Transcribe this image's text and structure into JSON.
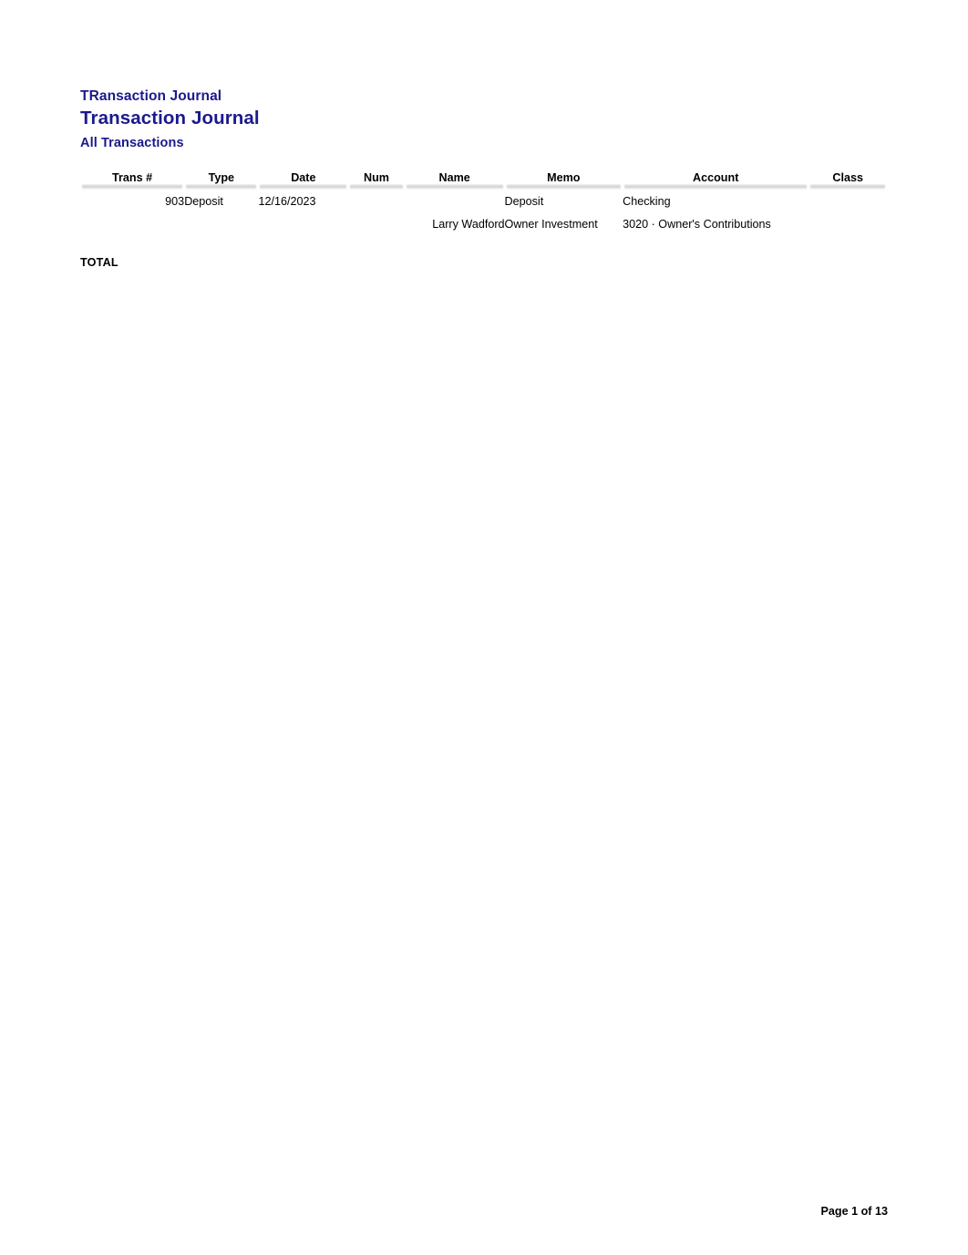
{
  "document": {
    "header_line_1": "TRansaction Journal",
    "header_line_2": "Transaction Journal",
    "subtitle": "All Transactions",
    "accent_color": "#1a1a8c",
    "text_color": "#000000",
    "rule_color": "#8c8c8c",
    "background": "#ffffff"
  },
  "table": {
    "columns": [
      {
        "key": "trans",
        "label": "Trans #"
      },
      {
        "key": "type",
        "label": "Type"
      },
      {
        "key": "date",
        "label": "Date"
      },
      {
        "key": "num",
        "label": "Num"
      },
      {
        "key": "name",
        "label": "Name"
      },
      {
        "key": "memo",
        "label": "Memo"
      },
      {
        "key": "account",
        "label": "Account"
      },
      {
        "key": "class",
        "label": "Class"
      }
    ],
    "rows": [
      {
        "trans": "903",
        "type": "Deposit",
        "date": "12/16/2023",
        "num": "",
        "name": "",
        "memo": "Deposit",
        "account": "Checking",
        "class": ""
      },
      {
        "trans": "",
        "type": "",
        "date": "",
        "num": "",
        "name": "Larry Wadford",
        "memo": "Owner Investment",
        "account": "3020 · Owner's Contributions",
        "class": ""
      }
    ],
    "total_label": "TOTAL",
    "total_value": ""
  },
  "footer": {
    "page_text": "Page 1 of 13"
  }
}
